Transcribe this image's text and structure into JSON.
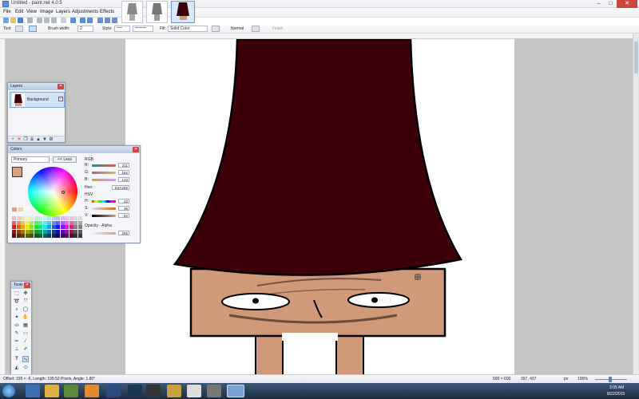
{
  "window": {
    "title": "Untitled - paint.net 4.0.5"
  },
  "menu": [
    "File",
    "Edit",
    "View",
    "Image",
    "Layers",
    "Adjustments",
    "Effects"
  ],
  "toolbar": {
    "tool_label": "Tool:",
    "brush_width_label": "Brush width:",
    "brush_width_value": "2",
    "style_label": "Style:",
    "fill_label": "Fill:",
    "fill_value": "Solid Color",
    "blend_value": "Normal",
    "finish_label": "Finish"
  },
  "layers_panel": {
    "title": "Layers",
    "layer_name": "Background"
  },
  "colors_panel": {
    "title": "Colors",
    "mode": "Primary",
    "less_button": "<< Less",
    "rgb_label": "RGB",
    "r_label": "R:",
    "r_value": "211",
    "g_label": "G:",
    "g_value": "162",
    "b_label": "B:",
    "b_value": "133",
    "hex_label": "Hex:",
    "hex_value": "D3A285",
    "hsv_label": "HSV",
    "h_label": "H:",
    "h_value": "22",
    "s_label": "S:",
    "s_value": "36",
    "v_label": "V:",
    "v_value": "82",
    "opacity_label": "Opacity - Alpha",
    "opacity_value": "255",
    "primary_color": "#D3A285"
  },
  "tools_panel": {
    "title": "Tools"
  },
  "status": {
    "left": "Offset: 195 × -6, Length: 199.52 Pixels, Angle: 1.80°",
    "size": "500 × 600",
    "coords": "397, 437",
    "unit": "px",
    "zoom": "195%"
  },
  "taskbar": {
    "time": "3:05 AM",
    "date": "8/22/2015"
  },
  "colors": {
    "hat": "#3c0008",
    "skin": "#d09a7a",
    "accent_blue": "#3f6fb3"
  }
}
